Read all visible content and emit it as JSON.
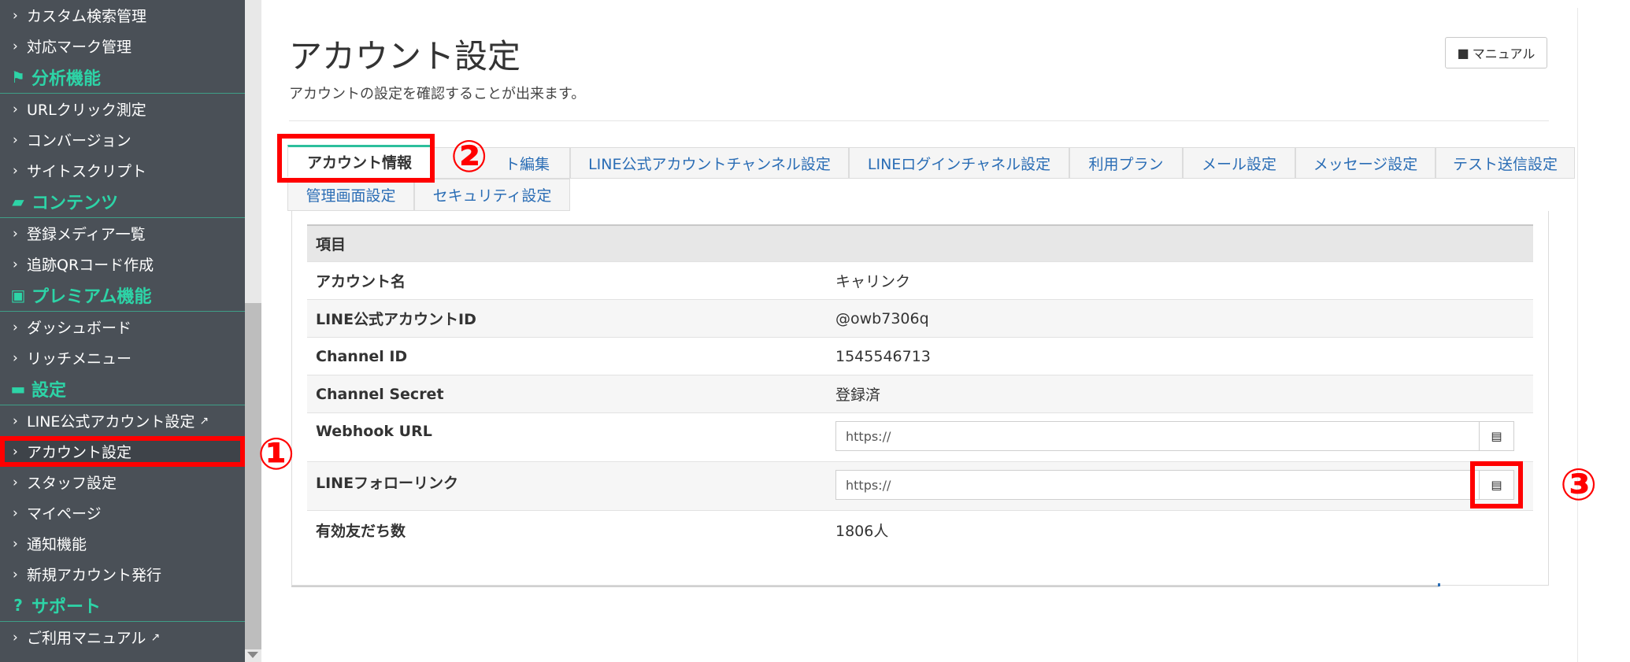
{
  "sidebar": {
    "items": [
      {
        "type": "link",
        "label": "カスタム検索管理"
      },
      {
        "type": "link",
        "label": "対応マーク管理"
      },
      {
        "type": "head",
        "label": "分析機能",
        "icon": "flag-icon"
      },
      {
        "type": "link",
        "label": "URLクリック測定"
      },
      {
        "type": "link",
        "label": "コンバージョン"
      },
      {
        "type": "link",
        "label": "サイトスクリプト"
      },
      {
        "type": "head",
        "label": "コンテンツ",
        "icon": "folder-icon"
      },
      {
        "type": "link",
        "label": "登録メディア一覧"
      },
      {
        "type": "link",
        "label": "追跡QRコード作成"
      },
      {
        "type": "head",
        "label": "プレミアム機能",
        "icon": "gift-icon"
      },
      {
        "type": "link",
        "label": "ダッシュボード"
      },
      {
        "type": "link",
        "label": "リッチメニュー"
      },
      {
        "type": "head",
        "label": "設定",
        "icon": "comment-icon"
      },
      {
        "type": "link",
        "label": "LINE公式アカウント設定",
        "external": true
      },
      {
        "type": "link",
        "label": "アカウント設定",
        "active": true
      },
      {
        "type": "link",
        "label": "スタッフ設定"
      },
      {
        "type": "link",
        "label": "マイページ"
      },
      {
        "type": "link",
        "label": "通知機能"
      },
      {
        "type": "link",
        "label": "新規アカウント発行"
      },
      {
        "type": "head",
        "label": "サポート",
        "icon": "question-icon"
      },
      {
        "type": "link",
        "label": "ご利用マニュアル",
        "external": true
      }
    ]
  },
  "header": {
    "title": "アカウント設定",
    "description": "アカウントの設定を確認することが出来ます。",
    "manual_label": "マニュアル"
  },
  "tabs": {
    "row1": [
      {
        "label": "アカウント情報",
        "active": true
      },
      {
        "label": "ト編集"
      },
      {
        "label": "LINE公式アカウントチャンネル設定"
      },
      {
        "label": "LINEログインチャネル設定"
      },
      {
        "label": "利用プラン"
      },
      {
        "label": "メール設定"
      },
      {
        "label": "メッセージ設定"
      },
      {
        "label": "テスト送信設定"
      }
    ],
    "row2": [
      {
        "label": "管理画面設定"
      },
      {
        "label": "セキュリティ設定"
      }
    ]
  },
  "table": {
    "header": "項目",
    "rows": [
      {
        "key": "アカウント名",
        "value": "キャリンク"
      },
      {
        "key": "LINE公式アカウントID",
        "value": "@owb7306q"
      },
      {
        "key": "Channel ID",
        "value": "1545546713"
      },
      {
        "key": "Channel Secret",
        "value": "登録済"
      },
      {
        "key": "Webhook URL",
        "input": "https://"
      },
      {
        "key": "LINEフォローリンク",
        "input": "https://"
      },
      {
        "key": "有効友だち数",
        "value": "1806人"
      }
    ]
  },
  "callouts": {
    "one": "①",
    "two": "②",
    "three": "③"
  },
  "colors": {
    "sidebar_bg": "#4a5057",
    "accent": "#2dd4a7",
    "link": "#2a6db5",
    "highlight": "#ff0000"
  }
}
